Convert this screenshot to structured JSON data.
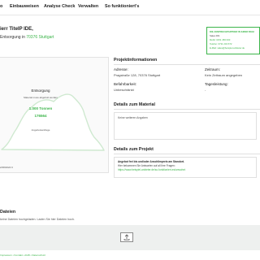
{
  "nav": {
    "items": [
      "o",
      "Einbauweisen",
      "Analyse Check",
      "Verwalten",
      "So funktioniert's"
    ]
  },
  "header": {
    "title": "ierr TiteIP IDE,",
    "sub_prefix": "Entsorgung",
    "sub_in": " in ",
    "sub_location": "70376 Stuttgart"
  },
  "contact": {
    "title": "DIE ANSPRECHPARTNER IN IHRER REGI",
    "lines": [
      "Sales 001",
      "Mobil: 0151 456 000",
      "Telefon: 0711 234 672",
      "E-Mail: sales@beispiel-anbieter.de"
    ]
  },
  "left_panel": {
    "category": "Entsorgung",
    "note": "Material muss abgeholt werden",
    "amount_line": "1.000  Tonnen",
    "id_line": "176564",
    "request_label": "Angebotsanfrage",
    "date": "2/28/2022 0"
  },
  "project_info": {
    "heading": "Projektinformationen",
    "address_label": "Adresse:",
    "address_value": "Pragstraße 128, 70376 Stuttgart",
    "period_label": "Zeitraum:",
    "period_value": "Kein Zeitraum angegeben",
    "passable_label": "Befahrbarkeit:",
    "passable_value": "Unbeschränkt",
    "daily_label": "Tagesleistung:",
    "daily_value": "-"
  },
  "material": {
    "heading": "Details zum Material",
    "text": "Keine weiteren Angaben"
  },
  "project": {
    "heading": "Details zum Projekt",
    "line1": "Angebot frei bis und/oder Anschlimpreis am Standort.",
    "line2": "Hier bekommen Sie Antworten auf all Ihre Fragen:",
    "line3": "https://www.beispiel-anbieter.de/so-funktioniert-es/anwohnt"
  },
  "files": {
    "heading": "Dateien",
    "note": "keine Dateien hochgeladen. Laden Sie hier Dateien hoch."
  },
  "footer": {
    "links": "Impressum • Kontakt • AGB • Datenschutz"
  },
  "colors": {
    "accent": "#3cb54a",
    "upload_bg": "#eef0ef"
  },
  "icons": {
    "upload": "upload-icon",
    "material_pile": "material-pile-icon"
  }
}
